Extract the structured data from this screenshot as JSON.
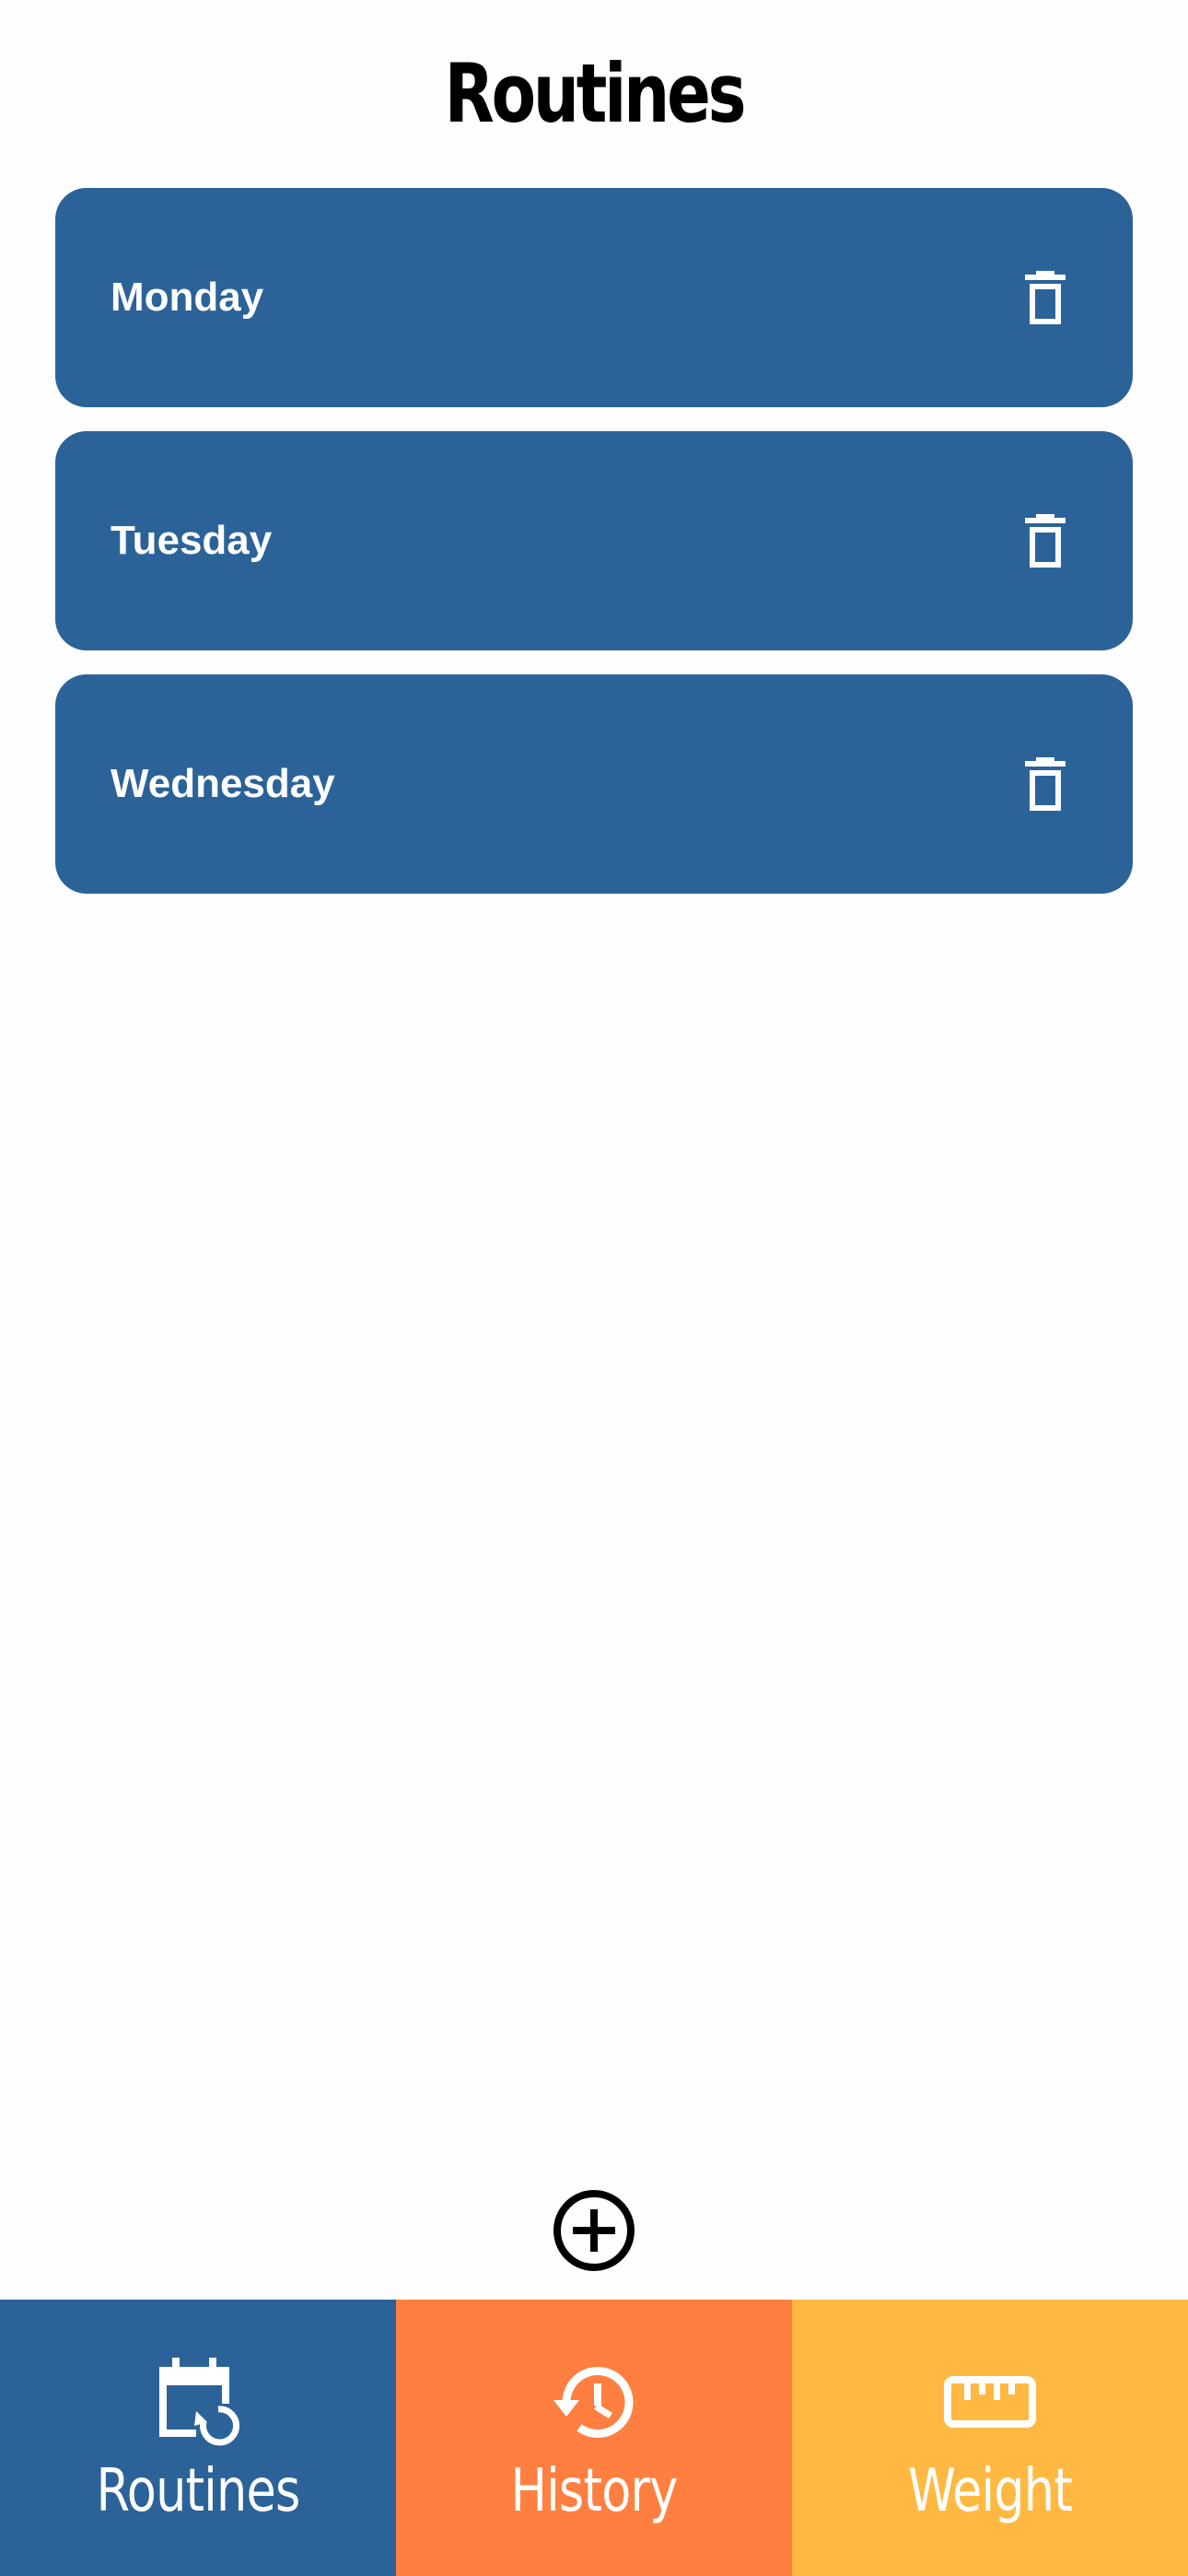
{
  "header": {
    "title": "Routines"
  },
  "routines": [
    {
      "name": "Monday",
      "delete_icon": "trash-icon"
    },
    {
      "name": "Tuesday",
      "delete_icon": "trash-icon"
    },
    {
      "name": "Wednesday",
      "delete_icon": "trash-icon"
    }
  ],
  "add_button": {
    "icon": "plus-circle-icon"
  },
  "tabs": [
    {
      "label": "Routines",
      "icon": "calendar-refresh-icon",
      "color": "#2b6399"
    },
    {
      "label": "History",
      "icon": "history-clock-icon",
      "color": "#ff7f40"
    },
    {
      "label": "Weight",
      "icon": "ruler-icon",
      "color": "#ffb943"
    }
  ],
  "colors": {
    "card": "#2b6399",
    "text_on_card": "#ffffff",
    "title": "#000000"
  }
}
